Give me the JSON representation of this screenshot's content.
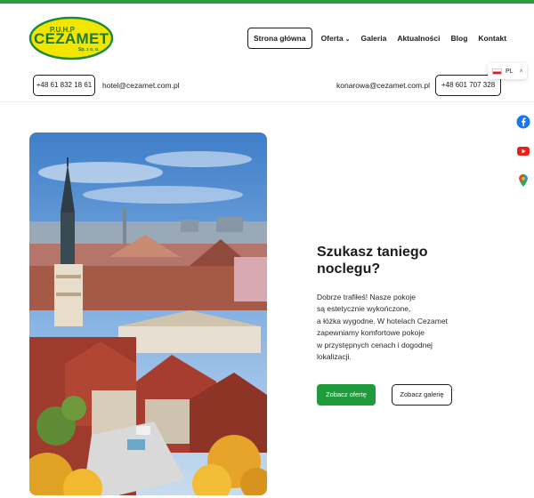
{
  "brand": {
    "logo_top": "P.U.H.P",
    "logo_main": "CEZAMET",
    "logo_sub": "Sp. z o. o."
  },
  "nav": {
    "items": [
      {
        "label": "Strona główna",
        "active": true
      },
      {
        "label": "Oferta",
        "has_dropdown": true
      },
      {
        "label": "Galeria"
      },
      {
        "label": "Aktualności"
      },
      {
        "label": "Blog"
      },
      {
        "label": "Kontakt"
      }
    ]
  },
  "contacts": {
    "phone_left": "+48 61 832 18 61",
    "email_left": "hotel@cezamet.com.pl",
    "email_right": "konarowa@cezamet.com.pl",
    "phone_right": "+48 601 707 328"
  },
  "language": {
    "selected": "PL",
    "icons": [
      "flag-pl-icon",
      "chevron-up-icon"
    ]
  },
  "social": [
    "facebook-icon",
    "youtube-icon",
    "map-pin-icon"
  ],
  "hero": {
    "headline": [
      "Szukasz taniego",
      "noclegu?"
    ],
    "description": [
      "Dobrze trafiłeś! Nasze pokoje",
      "są estetycznie wykończone,",
      "a łóżka wygodne. W hotelach Cezamet",
      "zapewniamy komfortowe pokoje",
      "w przystępnych cenach i dogodnej",
      "lokalizacji."
    ],
    "primary_button": "Zobacz ofertę",
    "secondary_button": "Zobacz galerię"
  },
  "colors": {
    "accent_green": "#1f9b3d",
    "logo_yellow": "#f2e600",
    "text_dark": "#1b1b1b"
  }
}
